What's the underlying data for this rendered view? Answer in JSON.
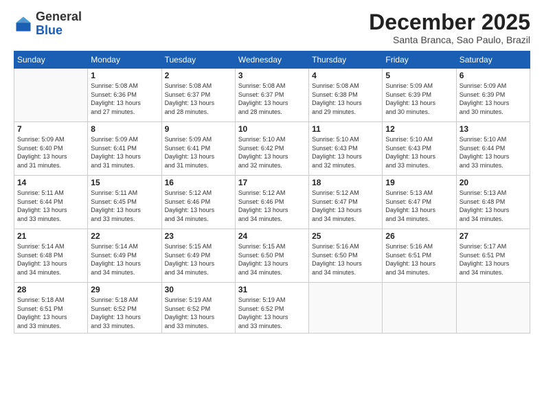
{
  "logo": {
    "general": "General",
    "blue": "Blue"
  },
  "header": {
    "month": "December 2025",
    "location": "Santa Branca, Sao Paulo, Brazil"
  },
  "weekdays": [
    "Sunday",
    "Monday",
    "Tuesday",
    "Wednesday",
    "Thursday",
    "Friday",
    "Saturday"
  ],
  "weeks": [
    [
      {
        "day": "",
        "info": ""
      },
      {
        "day": "1",
        "info": "Sunrise: 5:08 AM\nSunset: 6:36 PM\nDaylight: 13 hours\nand 27 minutes."
      },
      {
        "day": "2",
        "info": "Sunrise: 5:08 AM\nSunset: 6:37 PM\nDaylight: 13 hours\nand 28 minutes."
      },
      {
        "day": "3",
        "info": "Sunrise: 5:08 AM\nSunset: 6:37 PM\nDaylight: 13 hours\nand 28 minutes."
      },
      {
        "day": "4",
        "info": "Sunrise: 5:08 AM\nSunset: 6:38 PM\nDaylight: 13 hours\nand 29 minutes."
      },
      {
        "day": "5",
        "info": "Sunrise: 5:09 AM\nSunset: 6:39 PM\nDaylight: 13 hours\nand 30 minutes."
      },
      {
        "day": "6",
        "info": "Sunrise: 5:09 AM\nSunset: 6:39 PM\nDaylight: 13 hours\nand 30 minutes."
      }
    ],
    [
      {
        "day": "7",
        "info": "Sunrise: 5:09 AM\nSunset: 6:40 PM\nDaylight: 13 hours\nand 31 minutes."
      },
      {
        "day": "8",
        "info": "Sunrise: 5:09 AM\nSunset: 6:41 PM\nDaylight: 13 hours\nand 31 minutes."
      },
      {
        "day": "9",
        "info": "Sunrise: 5:09 AM\nSunset: 6:41 PM\nDaylight: 13 hours\nand 31 minutes."
      },
      {
        "day": "10",
        "info": "Sunrise: 5:10 AM\nSunset: 6:42 PM\nDaylight: 13 hours\nand 32 minutes."
      },
      {
        "day": "11",
        "info": "Sunrise: 5:10 AM\nSunset: 6:43 PM\nDaylight: 13 hours\nand 32 minutes."
      },
      {
        "day": "12",
        "info": "Sunrise: 5:10 AM\nSunset: 6:43 PM\nDaylight: 13 hours\nand 33 minutes."
      },
      {
        "day": "13",
        "info": "Sunrise: 5:10 AM\nSunset: 6:44 PM\nDaylight: 13 hours\nand 33 minutes."
      }
    ],
    [
      {
        "day": "14",
        "info": "Sunrise: 5:11 AM\nSunset: 6:44 PM\nDaylight: 13 hours\nand 33 minutes."
      },
      {
        "day": "15",
        "info": "Sunrise: 5:11 AM\nSunset: 6:45 PM\nDaylight: 13 hours\nand 33 minutes."
      },
      {
        "day": "16",
        "info": "Sunrise: 5:12 AM\nSunset: 6:46 PM\nDaylight: 13 hours\nand 34 minutes."
      },
      {
        "day": "17",
        "info": "Sunrise: 5:12 AM\nSunset: 6:46 PM\nDaylight: 13 hours\nand 34 minutes."
      },
      {
        "day": "18",
        "info": "Sunrise: 5:12 AM\nSunset: 6:47 PM\nDaylight: 13 hours\nand 34 minutes."
      },
      {
        "day": "19",
        "info": "Sunrise: 5:13 AM\nSunset: 6:47 PM\nDaylight: 13 hours\nand 34 minutes."
      },
      {
        "day": "20",
        "info": "Sunrise: 5:13 AM\nSunset: 6:48 PM\nDaylight: 13 hours\nand 34 minutes."
      }
    ],
    [
      {
        "day": "21",
        "info": "Sunrise: 5:14 AM\nSunset: 6:48 PM\nDaylight: 13 hours\nand 34 minutes."
      },
      {
        "day": "22",
        "info": "Sunrise: 5:14 AM\nSunset: 6:49 PM\nDaylight: 13 hours\nand 34 minutes."
      },
      {
        "day": "23",
        "info": "Sunrise: 5:15 AM\nSunset: 6:49 PM\nDaylight: 13 hours\nand 34 minutes."
      },
      {
        "day": "24",
        "info": "Sunrise: 5:15 AM\nSunset: 6:50 PM\nDaylight: 13 hours\nand 34 minutes."
      },
      {
        "day": "25",
        "info": "Sunrise: 5:16 AM\nSunset: 6:50 PM\nDaylight: 13 hours\nand 34 minutes."
      },
      {
        "day": "26",
        "info": "Sunrise: 5:16 AM\nSunset: 6:51 PM\nDaylight: 13 hours\nand 34 minutes."
      },
      {
        "day": "27",
        "info": "Sunrise: 5:17 AM\nSunset: 6:51 PM\nDaylight: 13 hours\nand 34 minutes."
      }
    ],
    [
      {
        "day": "28",
        "info": "Sunrise: 5:18 AM\nSunset: 6:51 PM\nDaylight: 13 hours\nand 33 minutes."
      },
      {
        "day": "29",
        "info": "Sunrise: 5:18 AM\nSunset: 6:52 PM\nDaylight: 13 hours\nand 33 minutes."
      },
      {
        "day": "30",
        "info": "Sunrise: 5:19 AM\nSunset: 6:52 PM\nDaylight: 13 hours\nand 33 minutes."
      },
      {
        "day": "31",
        "info": "Sunrise: 5:19 AM\nSunset: 6:52 PM\nDaylight: 13 hours\nand 33 minutes."
      },
      {
        "day": "",
        "info": ""
      },
      {
        "day": "",
        "info": ""
      },
      {
        "day": "",
        "info": ""
      }
    ]
  ]
}
